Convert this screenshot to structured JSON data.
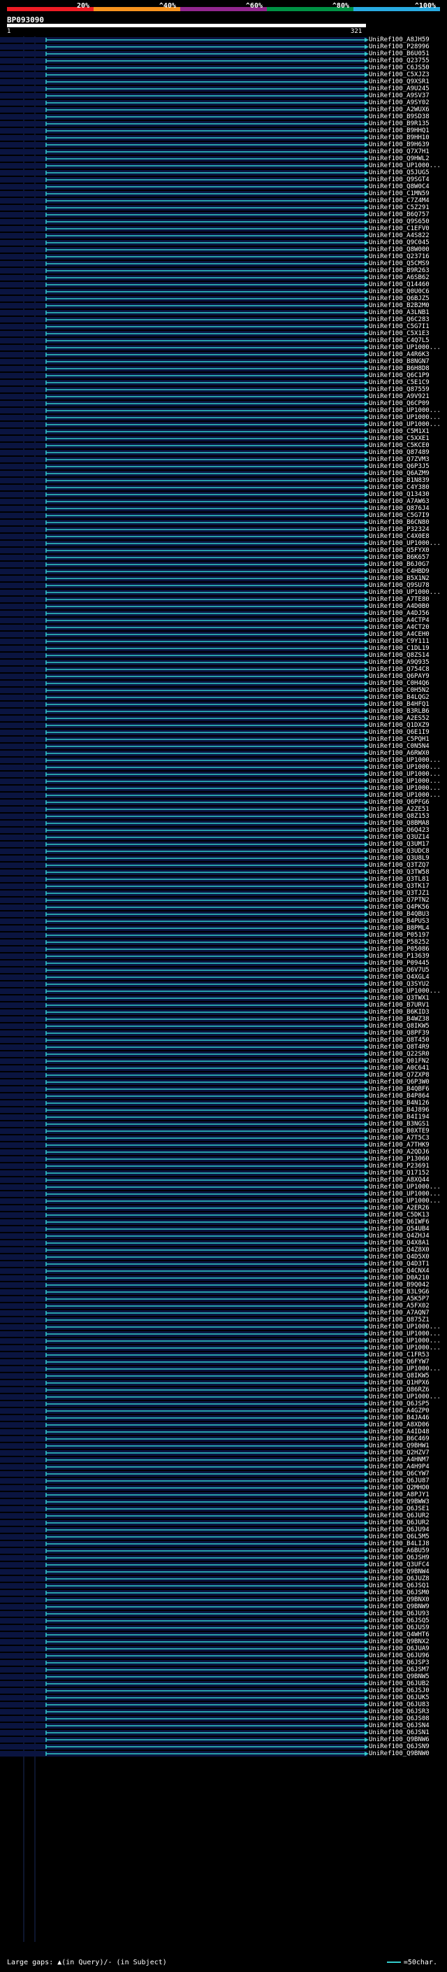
{
  "scale": {
    "labels": [
      "20%",
      "^40%",
      "^60%",
      "^80%",
      "^100%"
    ],
    "colors": [
      "#ee1c24",
      "#f7931e",
      "#92278f",
      "#009245",
      "#29abe2"
    ]
  },
  "query": {
    "id": "BP093090",
    "start": "1",
    "end": "321"
  },
  "hits": [
    {
      "id": "UniRef100_A8JH59"
    },
    {
      "id": "UniRef100_P28996"
    },
    {
      "id": "UniRef100_B6U051"
    },
    {
      "id": "UniRef100_Q23755"
    },
    {
      "id": "UniRef100_C6JS50"
    },
    {
      "id": "UniRef100_C5XJZ3"
    },
    {
      "id": "UniRef100_Q9XSR1"
    },
    {
      "id": "UniRef100_A9U245"
    },
    {
      "id": "UniRef100_A9SV37"
    },
    {
      "id": "UniRef100_A9SY02"
    },
    {
      "id": "UniRef100_A2WUX6"
    },
    {
      "id": "UniRef100_B9SD38"
    },
    {
      "id": "UniRef100_B9R135"
    },
    {
      "id": "UniRef100_B9HHQ1"
    },
    {
      "id": "UniRef100_B9HH10"
    },
    {
      "id": "UniRef100_B9H639"
    },
    {
      "id": "UniRef100_Q7X7H1"
    },
    {
      "id": "UniRef100_Q9HWL2"
    },
    {
      "id": "UniRef100_UP1000..."
    },
    {
      "id": "UniRef100_Q5JUG5"
    },
    {
      "id": "UniRef100_Q9SGT4"
    },
    {
      "id": "UniRef100_Q8W0C4"
    },
    {
      "id": "UniRef100_C1MN59"
    },
    {
      "id": "UniRef100_C7Z4M4"
    },
    {
      "id": "UniRef100_C5Z291"
    },
    {
      "id": "UniRef100_B6Q757"
    },
    {
      "id": "UniRef100_Q9S650"
    },
    {
      "id": "UniRef100_C1EFV0"
    },
    {
      "id": "UniRef100_A4S822"
    },
    {
      "id": "UniRef100_Q9C045"
    },
    {
      "id": "UniRef100_Q8W000"
    },
    {
      "id": "UniRef100_Q23716"
    },
    {
      "id": "UniRef100_Q5CMS9"
    },
    {
      "id": "UniRef100_B9R263"
    },
    {
      "id": "UniRef100_A6SB62"
    },
    {
      "id": "UniRef100_Q14460"
    },
    {
      "id": "UniRef100_Q0U0C6"
    },
    {
      "id": "UniRef100_Q6BJZ5"
    },
    {
      "id": "UniRef100_B2B2M0"
    },
    {
      "id": "UniRef100_A3LNB1"
    },
    {
      "id": "UniRef100_Q6C283"
    },
    {
      "id": "UniRef100_C5G7I1"
    },
    {
      "id": "UniRef100_C5X1E3"
    },
    {
      "id": "UniRef100_C4Q7L5"
    },
    {
      "id": "UniRef100_UP1000..."
    },
    {
      "id": "UniRef100_A4R6K3"
    },
    {
      "id": "UniRef100_B8NGN7"
    },
    {
      "id": "UniRef100_B6H8D8"
    },
    {
      "id": "UniRef100_Q6C1P9"
    },
    {
      "id": "UniRef100_C5E1C9"
    },
    {
      "id": "UniRef100_Q87559"
    },
    {
      "id": "UniRef100_A9V921"
    },
    {
      "id": "UniRef100_Q6CP09"
    },
    {
      "id": "UniRef100_UP1000..."
    },
    {
      "id": "UniRef100_UP1000..."
    },
    {
      "id": "UniRef100_UP1000..."
    },
    {
      "id": "UniRef100_C5M1X1"
    },
    {
      "id": "UniRef100_C5XXE1"
    },
    {
      "id": "UniRef100_C5KCE0"
    },
    {
      "id": "UniRef100_Q87489"
    },
    {
      "id": "UniRef100_Q7ZVM3"
    },
    {
      "id": "UniRef100_Q6P3J5"
    },
    {
      "id": "UniRef100_Q6AZM9"
    },
    {
      "id": "UniRef100_B1N839"
    },
    {
      "id": "UniRef100_C4Y380"
    },
    {
      "id": "UniRef100_Q13430"
    },
    {
      "id": "UniRef100_A7AW63"
    },
    {
      "id": "UniRef100_Q876J4"
    },
    {
      "id": "UniRef100_C5G7I9"
    },
    {
      "id": "UniRef100_B6CN80"
    },
    {
      "id": "UniRef100_P32324"
    },
    {
      "id": "UniRef100_C4X0E8"
    },
    {
      "id": "UniRef100_UP1000..."
    },
    {
      "id": "UniRef100_Q5FYX0"
    },
    {
      "id": "UniRef100_B6K657"
    },
    {
      "id": "UniRef100_B6J0G7"
    },
    {
      "id": "UniRef100_C4HBD9"
    },
    {
      "id": "UniRef100_B5X1N2"
    },
    {
      "id": "UniRef100_Q9SU78"
    },
    {
      "id": "UniRef100_UP1000..."
    },
    {
      "id": "UniRef100_A7TE80"
    },
    {
      "id": "UniRef100_A4D0B0"
    },
    {
      "id": "UniRef100_A4DJ56"
    },
    {
      "id": "UniRef100_A4CTP4"
    },
    {
      "id": "UniRef100_A4CT20"
    },
    {
      "id": "UniRef100_A4CEH0"
    },
    {
      "id": "UniRef100_C9Y111"
    },
    {
      "id": "UniRef100_C1DL19"
    },
    {
      "id": "UniRef100_Q8ZS14"
    },
    {
      "id": "UniRef100_A9Q935"
    },
    {
      "id": "UniRef100_Q754C8"
    },
    {
      "id": "UniRef100_Q6PAY9"
    },
    {
      "id": "UniRef100_C0H4Q6"
    },
    {
      "id": "UniRef100_C0H5N2"
    },
    {
      "id": "UniRef100_B4LQG2"
    },
    {
      "id": "UniRef100_B4HFQ1"
    },
    {
      "id": "UniRef100_B3RLB6"
    },
    {
      "id": "UniRef100_A2ES52"
    },
    {
      "id": "UniRef100_Q1DXZ9"
    },
    {
      "id": "UniRef100_Q6E1I9"
    },
    {
      "id": "UniRef100_C5PQH1"
    },
    {
      "id": "UniRef100_C0N5N4"
    },
    {
      "id": "UniRef100_A6RWX0"
    },
    {
      "id": "UniRef100_UP1000..."
    },
    {
      "id": "UniRef100_UP1000..."
    },
    {
      "id": "UniRef100_UP1000..."
    },
    {
      "id": "UniRef100_UP1000..."
    },
    {
      "id": "UniRef100_UP1000..."
    },
    {
      "id": "UniRef100_UP1000..."
    },
    {
      "id": "UniRef100_Q6PFG6"
    },
    {
      "id": "UniRef100_A2ZE51"
    },
    {
      "id": "UniRef100_Q8Z153"
    },
    {
      "id": "UniRef100_Q8BMA8"
    },
    {
      "id": "UniRef100_Q6Q423"
    },
    {
      "id": "UniRef100_Q3UZ14"
    },
    {
      "id": "UniRef100_Q3UM17"
    },
    {
      "id": "UniRef100_Q3UDC8"
    },
    {
      "id": "UniRef100_Q3U8L9"
    },
    {
      "id": "UniRef100_Q3TZQ7"
    },
    {
      "id": "UniRef100_Q3TW58"
    },
    {
      "id": "UniRef100_Q3TL81"
    },
    {
      "id": "UniRef100_Q3TK17"
    },
    {
      "id": "UniRef100_Q3TJZ1"
    },
    {
      "id": "UniRef100_Q7PTN2"
    },
    {
      "id": "UniRef100_Q4PK56"
    },
    {
      "id": "UniRef100_B4QBU3"
    },
    {
      "id": "UniRef100_B4PUS3"
    },
    {
      "id": "UniRef100_B8PML4"
    },
    {
      "id": "UniRef100_P05197"
    },
    {
      "id": "UniRef100_P58252"
    },
    {
      "id": "UniRef100_P05086"
    },
    {
      "id": "UniRef100_P13639"
    },
    {
      "id": "UniRef100_P09445"
    },
    {
      "id": "UniRef100_Q6V7U5"
    },
    {
      "id": "UniRef100_Q4XGL4"
    },
    {
      "id": "UniRef100_Q3SYU2"
    },
    {
      "id": "UniRef100_UP1000..."
    },
    {
      "id": "UniRef100_Q3TWX1"
    },
    {
      "id": "UniRef100_B7URV1"
    },
    {
      "id": "UniRef100_B6KID3"
    },
    {
      "id": "UniRef100_B4WZ38"
    },
    {
      "id": "UniRef100_Q8IKW5"
    },
    {
      "id": "UniRef100_Q8PF39"
    },
    {
      "id": "UniRef100_Q8T450"
    },
    {
      "id": "UniRef100_Q8T4R9"
    },
    {
      "id": "UniRef100_Q22SR0"
    },
    {
      "id": "UniRef100_Q01FN2"
    },
    {
      "id": "UniRef100_A0C641"
    },
    {
      "id": "UniRef100_Q7ZXP8"
    },
    {
      "id": "UniRef100_Q6P3W0"
    },
    {
      "id": "UniRef100_B4QBF6"
    },
    {
      "id": "UniRef100_B4P864"
    },
    {
      "id": "UniRef100_B4N126"
    },
    {
      "id": "UniRef100_B4J896"
    },
    {
      "id": "UniRef100_B4I194"
    },
    {
      "id": "UniRef100_B3NGS1"
    },
    {
      "id": "UniRef100_B0XTE9"
    },
    {
      "id": "UniRef100_A7T5C3"
    },
    {
      "id": "UniRef100_A7THK9"
    },
    {
      "id": "UniRef100_A2QDJ6"
    },
    {
      "id": "UniRef100_P13060"
    },
    {
      "id": "UniRef100_P23691"
    },
    {
      "id": "UniRef100_Q17152"
    },
    {
      "id": "UniRef100_A8XQ44"
    },
    {
      "id": "UniRef100_UP1000..."
    },
    {
      "id": "UniRef100_UP1000..."
    },
    {
      "id": "UniRef100_UP1000..."
    },
    {
      "id": "UniRef100_A2ER26"
    },
    {
      "id": "UniRef100_C5DK13"
    },
    {
      "id": "UniRef100_Q6IWF6"
    },
    {
      "id": "UniRef100_Q54UB4"
    },
    {
      "id": "UniRef100_Q4ZHJ4"
    },
    {
      "id": "UniRef100_Q4X8A1"
    },
    {
      "id": "UniRef100_Q4Z8X0"
    },
    {
      "id": "UniRef100_Q4D5X0"
    },
    {
      "id": "UniRef100_Q4D3T1"
    },
    {
      "id": "UniRef100_Q4CNX4"
    },
    {
      "id": "UniRef100_D0A210"
    },
    {
      "id": "UniRef100_B9Q042"
    },
    {
      "id": "UniRef100_B3L9G6"
    },
    {
      "id": "UniRef100_A5K5P7"
    },
    {
      "id": "UniRef100_A5FX02"
    },
    {
      "id": "UniRef100_A7AQN7"
    },
    {
      "id": "UniRef100_Q875Z1"
    },
    {
      "id": "UniRef100_UP1000..."
    },
    {
      "id": "UniRef100_UP1000..."
    },
    {
      "id": "UniRef100_UP1000..."
    },
    {
      "id": "UniRef100_UP1000..."
    },
    {
      "id": "UniRef100_C1FR53"
    },
    {
      "id": "UniRef100_Q6FYW7"
    },
    {
      "id": "UniRef100_UP1000..."
    },
    {
      "id": "UniRef100_Q8IKW5"
    },
    {
      "id": "UniRef100_Q1HPX6"
    },
    {
      "id": "UniRef100_Q86RZ6"
    },
    {
      "id": "UniRef100_UP1000..."
    },
    {
      "id": "UniRef100_Q6JSP5"
    },
    {
      "id": "UniRef100_A4GZP0"
    },
    {
      "id": "UniRef100_B4JA46"
    },
    {
      "id": "UniRef100_A8XD06"
    },
    {
      "id": "UniRef100_A4ID48"
    },
    {
      "id": "UniRef100_B6C469"
    },
    {
      "id": "UniRef100_Q9BHW1"
    },
    {
      "id": "UniRef100_Q2HZV7"
    },
    {
      "id": "UniRef100_A4HNM7"
    },
    {
      "id": "UniRef100_A4H9P4"
    },
    {
      "id": "UniRef100_Q6CYW7"
    },
    {
      "id": "UniRef100_Q6JU87"
    },
    {
      "id": "UniRef100_Q2MHO0"
    },
    {
      "id": "UniRef100_A8PJY1"
    },
    {
      "id": "UniRef100_Q9BWW3"
    },
    {
      "id": "UniRef100_Q6JSE1"
    },
    {
      "id": "UniRef100_Q6JUR2"
    },
    {
      "id": "UniRef100_Q6JUR2"
    },
    {
      "id": "UniRef100_Q6JU94"
    },
    {
      "id": "UniRef100_Q6L5M5"
    },
    {
      "id": "UniRef100_B4LIJ8"
    },
    {
      "id": "UniRef100_A6BU59"
    },
    {
      "id": "UniRef100_Q6JSH9"
    },
    {
      "id": "UniRef100_Q3UFC4"
    },
    {
      "id": "UniRef100_Q9BNW4"
    },
    {
      "id": "UniRef100_Q6JUZ8"
    },
    {
      "id": "UniRef100_Q6JSQ1"
    },
    {
      "id": "UniRef100_Q6JSM0"
    },
    {
      "id": "UniRef100_Q9BNX0"
    },
    {
      "id": "UniRef100_Q9BNW9"
    },
    {
      "id": "UniRef100_Q6JU93"
    },
    {
      "id": "UniRef100_Q6JSQ5"
    },
    {
      "id": "UniRef100_Q6JUS9"
    },
    {
      "id": "UniRef100_Q4WHT6"
    },
    {
      "id": "UniRef100_Q9BNX2"
    },
    {
      "id": "UniRef100_Q6JUA9"
    },
    {
      "id": "UniRef100_Q6JU96"
    },
    {
      "id": "UniRef100_Q6JSP3"
    },
    {
      "id": "UniRef100_Q6JSM7"
    },
    {
      "id": "UniRef100_Q9BNW5"
    },
    {
      "id": "UniRef100_Q6JUB2"
    },
    {
      "id": "UniRef100_Q6JSJ0"
    },
    {
      "id": "UniRef100_Q6JUK5"
    },
    {
      "id": "UniRef100_Q6JU83"
    },
    {
      "id": "UniRef100_Q6JSR3"
    },
    {
      "id": "UniRef100_Q6JS08"
    },
    {
      "id": "UniRef100_Q6JSN4"
    },
    {
      "id": "UniRef100_Q6JSN1"
    },
    {
      "id": "UniRef100_Q9BNW6"
    },
    {
      "id": "UniRef100_Q6JSN9"
    },
    {
      "id": "UniRef100_Q9BNW0"
    }
  ],
  "legend": {
    "gaps_text": "Large gaps: ▲(in Query)/- (in Subject)",
    "scale_text": "=50char.",
    "line_color": "#33cccc"
  }
}
